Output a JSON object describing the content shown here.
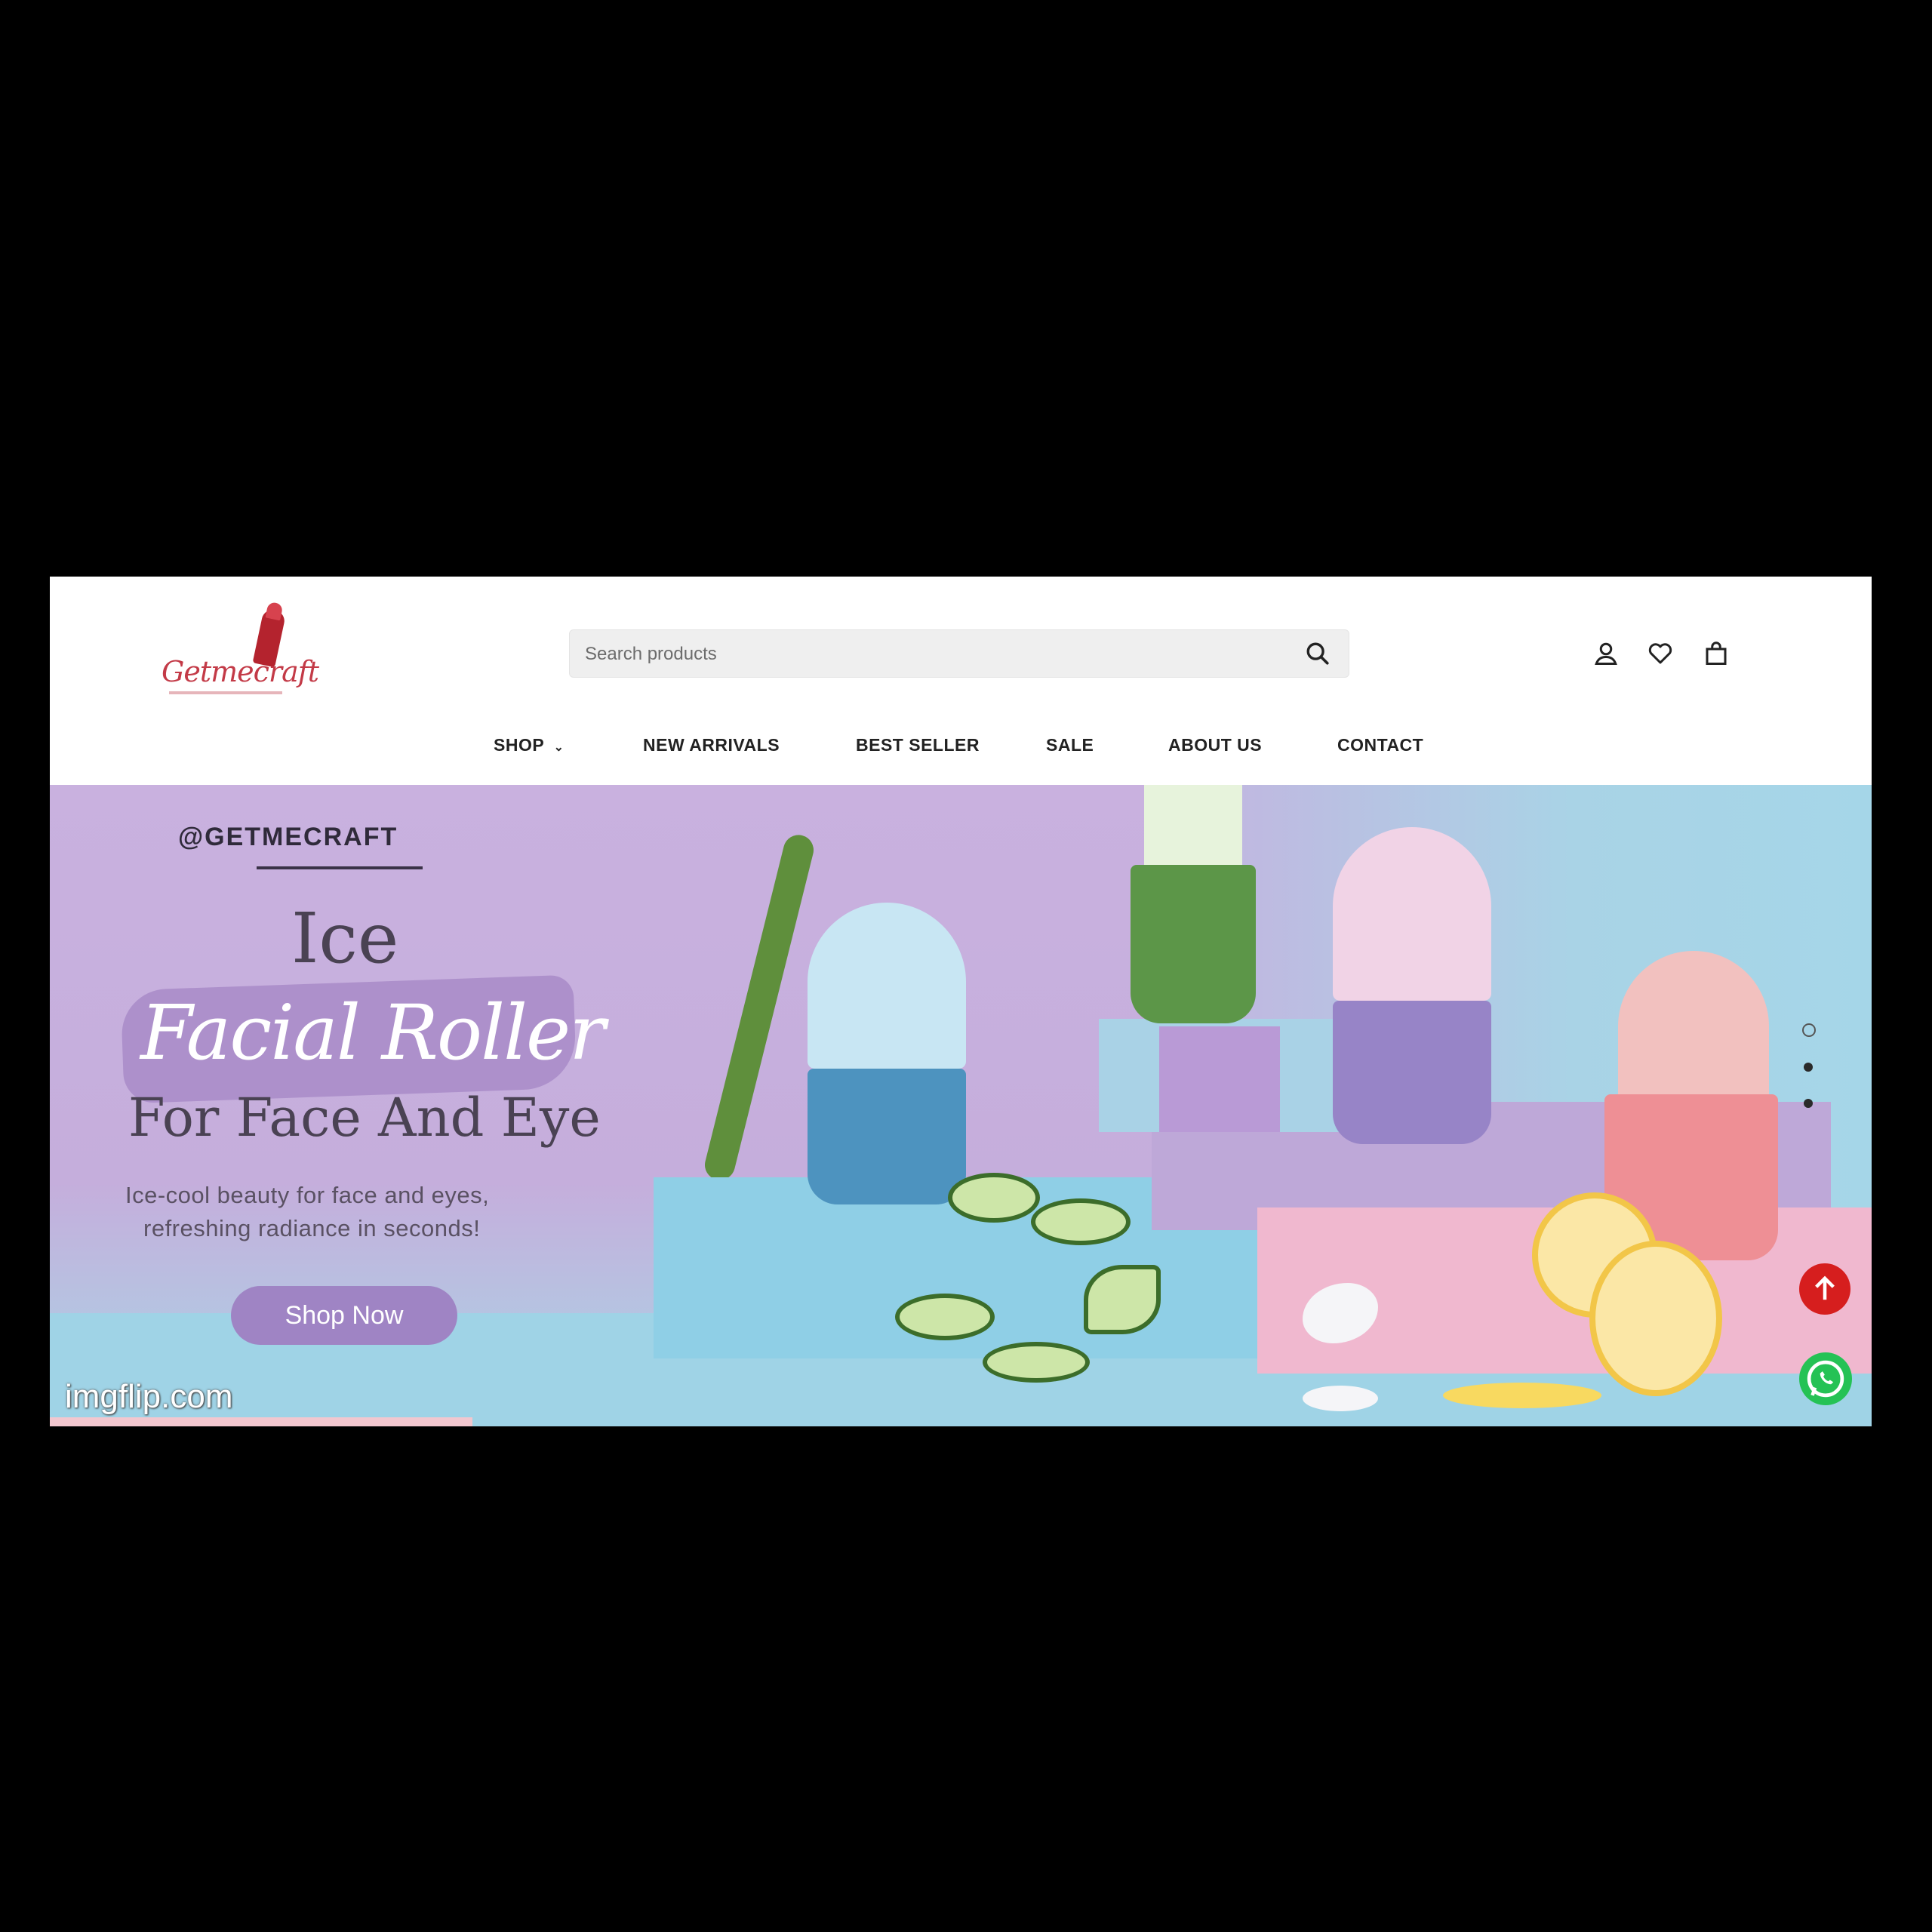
{
  "brand": {
    "logo_text": "Getmecraft"
  },
  "search": {
    "placeholder": "Search products"
  },
  "header_icons": [
    "user-icon",
    "heart-icon",
    "bag-icon"
  ],
  "nav": {
    "items": [
      {
        "label": "SHOP",
        "has_dropdown": true
      },
      {
        "label": "NEW ARRIVALS"
      },
      {
        "label": "BEST SELLER"
      },
      {
        "label": "SALE"
      },
      {
        "label": "ABOUT US"
      },
      {
        "label": "CONTACT"
      }
    ]
  },
  "hero": {
    "handle": "@GETMECRAFT",
    "title_line1": "Ice",
    "title_script": "Facial Roller",
    "title_line3": "For Face And Eye",
    "description_line1": "Ice-cool beauty for face and eyes,",
    "description_line2": "refreshing radiance in seconds!",
    "cta_label": "Shop Now",
    "slides_total": 3,
    "active_slide": 1
  },
  "floating": {
    "scroll_top_icon": "arrow-up-icon",
    "chat_icon": "whatsapp-icon"
  },
  "watermark": "imgflip.com",
  "colors": {
    "hero_purple": "#c9b1df",
    "cta_purple": "#9f84c4",
    "scroll_top_red": "#d61e1e",
    "whatsapp_green": "#25c255"
  }
}
